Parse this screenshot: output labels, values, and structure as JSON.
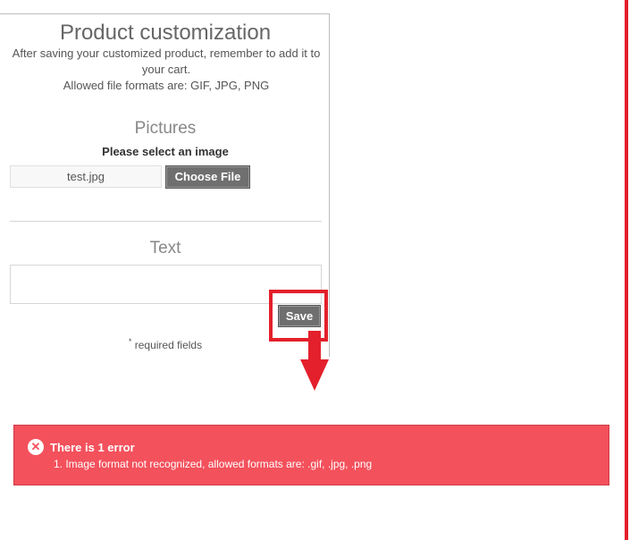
{
  "customization": {
    "title": "Product customization",
    "help_line1": "After saving your customized product, remember to add it to your cart.",
    "help_line2": "Allowed file formats are: GIF, JPG, PNG",
    "pictures_title": "Pictures",
    "select_image_label": "Please select an image",
    "file_name": "test.jpg",
    "choose_file_label": "Choose File",
    "text_title": "Text",
    "text_value": "",
    "save_label": "Save",
    "required_mark": "*",
    "required_label": "required fields"
  },
  "error": {
    "icon": "close-circle-icon",
    "title": "There is 1 error",
    "item": "1. Image format not recognized, allowed formats are: .gif, .jpg, .png",
    "color": "#f3515c"
  },
  "annotation": {
    "color": "#e3202b",
    "arrow_icon": "arrow-down-icon"
  }
}
